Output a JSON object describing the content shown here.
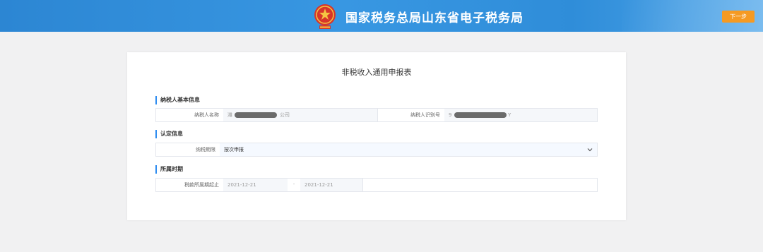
{
  "header": {
    "title": "国家税务总局山东省电子税务局",
    "next_button": "下一步",
    "emblem_icon": "tax-emblem-icon",
    "colors": {
      "bar": "#3391dc",
      "button": "#f59a23"
    }
  },
  "form": {
    "title": "非税收入通用申报表",
    "sections": {
      "taxpayer": {
        "title": "纳税人基本信息",
        "name_label": "纳税人名称",
        "name_value_prefix": "潍",
        "name_value_suffix": "公司",
        "id_label": "纳税人识别号",
        "id_value_prefix": "9",
        "id_value_suffix": "Y"
      },
      "certification": {
        "title": "认定信息",
        "period_label": "纳税期限",
        "period_value": "按次申报",
        "chevron_icon": "chevron-down-icon"
      },
      "period": {
        "title": "所属时期",
        "range_label": "税款所属期起止",
        "start_date": "2021-12-21",
        "separator": "-",
        "end_date": "2021-12-21"
      }
    }
  }
}
